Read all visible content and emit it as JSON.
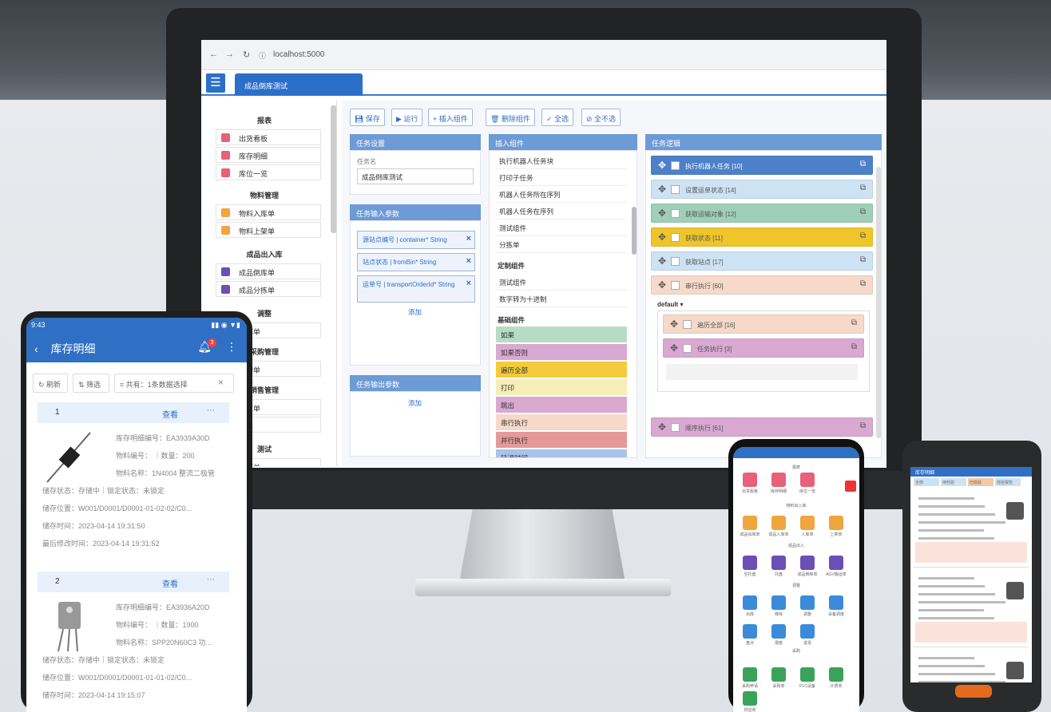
{
  "browser": {
    "url": "localhost:5000"
  },
  "app": {
    "tab_title": "成品倒库测试"
  },
  "sidebar": {
    "groups": [
      "报表",
      "物料管理",
      "成品出入库",
      "调整",
      "采购管理",
      "销售管理",
      "测试"
    ],
    "items": [
      "出货看板",
      "库存明细",
      "库位一览",
      "物料入库单",
      "物料上架单",
      "成品倒库单",
      "成品分拣单",
      "移库单",
      "采购单",
      "出库单",
      "货单",
      "出库单"
    ]
  },
  "toolbar": [
    "保存",
    "运行",
    "插入组件",
    "删除组件",
    "全选",
    "全不选"
  ],
  "panels": {
    "settings": {
      "title": "任务设置",
      "label": "任务名",
      "value": "成品倒库测试"
    },
    "inputs": {
      "title": "任务输入参数",
      "chips": [
        "源站点编号 | container* String",
        "站点状态 | fromBin* String",
        "运单号 | transportOrderId* String"
      ],
      "add": "添加"
    },
    "outputs": {
      "title": "任务输出参数",
      "add": "添加"
    },
    "components": {
      "title": "插入组件",
      "list": [
        "执行机器人任务块",
        "打印子任务",
        "机器人任务所在序列",
        "机器人任务在序列",
        "测试组件",
        "分拣单"
      ],
      "custom_title": "定制组件",
      "custom": [
        "测试组件",
        "数字转为十进制"
      ],
      "basic_title": "基础组件",
      "basic": [
        {
          "label": "如果",
          "color": "#b7dcc5"
        },
        {
          "label": "如果否则",
          "color": "#d9a9d2"
        },
        {
          "label": "遍历全部",
          "color": "#f3cb3c"
        },
        {
          "label": "打印",
          "color": "#f5eeb8"
        },
        {
          "label": "跳出",
          "color": "#d9a9d2"
        },
        {
          "label": "串行执行",
          "color": "#f6d9c9"
        },
        {
          "label": "并行执行",
          "color": "#e39a98"
        },
        {
          "label": "延迟时间",
          "color": "#a9c3e7"
        }
      ]
    },
    "logic": {
      "title": "任务逻辑",
      "default_label": "default"
    }
  },
  "logic_nodes": [
    {
      "label": "执行机器人任务 [10]",
      "color": "#4c80c9"
    },
    {
      "label": "设置运单状态 [14]",
      "color": "#cde3f4"
    },
    {
      "label": "获取运输对象 [12]",
      "color": "#9fcfb7"
    },
    {
      "label": "获取状态 [11]",
      "color": "#f0c52a"
    },
    {
      "label": "获取站点 [17]",
      "color": "#cde3f4"
    },
    {
      "label": "串行执行 [60]",
      "color": "#f6d9c9"
    },
    {
      "label": "遍历全部 [16]",
      "color": "#f6d9c9"
    },
    {
      "label": "任务执行 [3]",
      "color": "#d9a9d2"
    },
    {
      "label": "顺序执行 [61]",
      "color": "#d9a9d2"
    }
  ],
  "tablet": {
    "time": "9:43",
    "title": "库存明细",
    "badge": "3",
    "filters": [
      "刷新",
      "筛选",
      "共有：1条数据选择"
    ],
    "rows": [
      {
        "no": "1",
        "action": "查看",
        "code": "EA3939A30D",
        "qty": "200",
        "name": "1N4004 整流二极管",
        "state": "存储中",
        "lock": "未锁定",
        "loc": "W001/D0001/D0001-01-02-02/C0...",
        "time1": "2023-04-14 19:31:50",
        "time2": "2023-04-14 19:31:52"
      },
      {
        "no": "2",
        "action": "查看",
        "code": "EA3936A20D",
        "qty": "1900",
        "name": "SPP20N60C3 功...",
        "state": "存储中",
        "lock": "未锁定",
        "loc": "W001/D0001/D0001-01-01-02/C0...",
        "time1": "2023-04-14 19:15:07"
      }
    ],
    "labels": {
      "code": "库存明细编号：",
      "qty": "物料编号： ｜数量：",
      "name": "物料名称：",
      "state": "储存状态：",
      "lock": "｜锁定状态：",
      "loc": "储存位置：",
      "time1": "储存时间：",
      "time2": "最后修改时间："
    }
  },
  "phone1": {
    "sections": [
      "报表",
      "物料出入库",
      "成品出入",
      "调整",
      "采购"
    ],
    "icons": [
      {
        "label": "出货看板",
        "color": "#e8607a"
      },
      {
        "label": "库存明细",
        "color": "#e8607a"
      },
      {
        "label": "库位一览",
        "color": "#e8607a"
      },
      {
        "label": "成品出库单",
        "color": "#f0a53e"
      },
      {
        "label": "成品入库单",
        "color": "#f0a53e"
      },
      {
        "label": "入库单",
        "color": "#f0a53e"
      },
      {
        "label": "上架单",
        "color": "#f0a53e"
      },
      {
        "label": "空托盘",
        "color": "#6b4fb4"
      },
      {
        "label": "托盘",
        "color": "#6b4fb4"
      },
      {
        "label": "成品倒库单",
        "color": "#6b4fb4"
      },
      {
        "label": "AGV搬运单",
        "color": "#6b4fb4"
      },
      {
        "label": "出库",
        "color": "#3b8bd8"
      },
      {
        "label": "移库",
        "color": "#3b8bd8"
      },
      {
        "label": "调整",
        "color": "#3b8bd8"
      },
      {
        "label": "设备调度",
        "color": "#3b8bd8"
      },
      {
        "label": "盘点",
        "color": "#3b8bd8"
      },
      {
        "label": "报废",
        "color": "#3b8bd8"
      },
      {
        "label": "退货",
        "color": "#3b8bd8"
      },
      {
        "label": "采购申请",
        "color": "#3aa35a"
      },
      {
        "label": "采购单",
        "color": "#3aa35a"
      },
      {
        "label": "PLC设备",
        "color": "#3aa35a"
      },
      {
        "label": "计费单",
        "color": "#3aa35a"
      },
      {
        "label": "供应商",
        "color": "#3aa35a"
      }
    ]
  },
  "phone2": {
    "header": "库存明细",
    "tabs": [
      "全部",
      "待检验",
      "已检验",
      "检验报告"
    ]
  }
}
